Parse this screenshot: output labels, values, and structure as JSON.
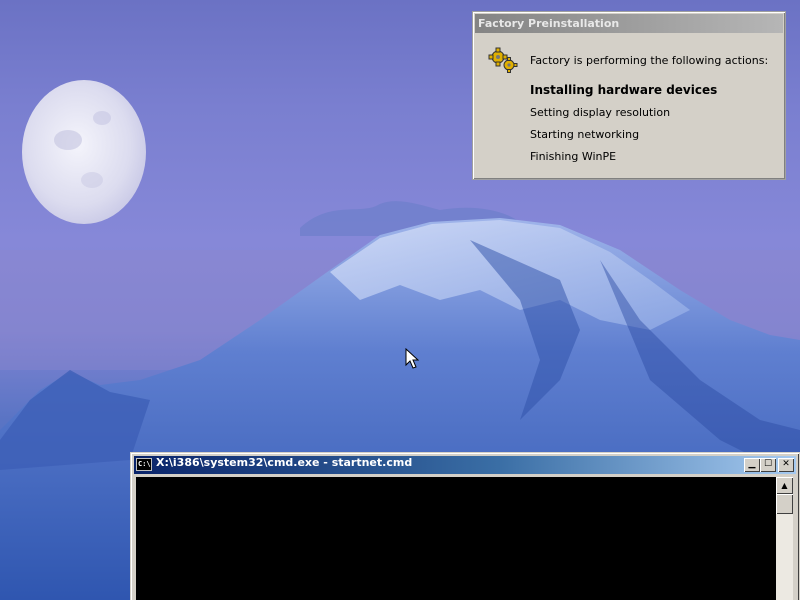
{
  "factory_dialog": {
    "title": "Factory Preinstallation",
    "header": "Factory is performing the following actions:",
    "icon": "gears-icon",
    "actions": [
      {
        "label": "Installing hardware devices",
        "state": "current"
      },
      {
        "label": "Setting display resolution",
        "state": "pending"
      },
      {
        "label": "Starting networking",
        "state": "pending"
      },
      {
        "label": "Finishing WinPE",
        "state": "pending"
      }
    ]
  },
  "cmd_window": {
    "title": "X:\\i386\\system32\\cmd.exe - startnet.cmd",
    "icon_text": "C:\\",
    "buttons": {
      "minimize": "▁",
      "maximize": "☐",
      "close": "✕"
    },
    "scroll_up": "▲"
  },
  "colors": {
    "desktop_sky": "#7a7fd0",
    "mountain": "#3f66b8",
    "dialog_face": "#d4d0c8",
    "cmd_title_active": "#0a246a",
    "console_background": "#000000"
  }
}
